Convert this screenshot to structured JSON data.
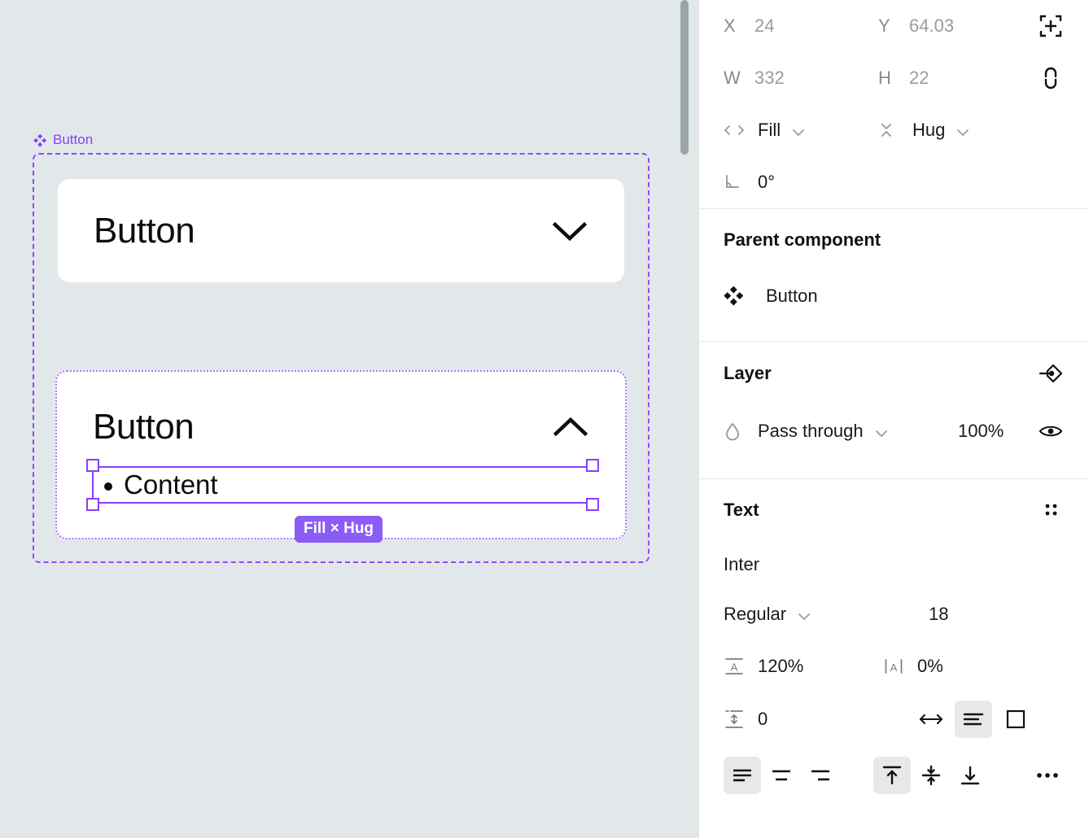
{
  "canvas": {
    "background_color": "#e2e8e9",
    "component_label": "Button",
    "component_icon": "component-diamond-icon",
    "button_one": {
      "label": "Button",
      "chevron": "chevron-down-icon"
    },
    "button_two": {
      "label": "Button",
      "chevron": "chevron-up-icon"
    },
    "content_item": {
      "text": "Content",
      "bullet": "bullet-dot-icon"
    },
    "size_badge": "Fill × Hug",
    "size_badge_color": "#8b5cf6",
    "selection_color": "#8b3dff"
  },
  "panel": {
    "position": {
      "x_label": "X",
      "x_value": "24",
      "y_label": "Y",
      "y_value": "64.03",
      "w_label": "W",
      "w_value": "332",
      "h_label": "H",
      "h_value": "22",
      "align_icon": "set-position-crosshair-icon",
      "ratio_icon": "unlink-aspect-ratio-icon",
      "horizontal_resize_icon": "horizontal-resize-icon",
      "horizontal_resize_value": "Fill",
      "vertical_resize_icon": "vertical-resize-icon",
      "vertical_resize_value": "Hug",
      "rotation_icon": "rotation-angle-icon",
      "rotation_value": "0°"
    },
    "parent_component": {
      "title": "Parent component",
      "icon": "component-diamond-icon",
      "name": "Button"
    },
    "layer": {
      "title": "Layer",
      "annotate_icon": "add-annotation-icon",
      "blend_icon": "blend-mode-drop-icon",
      "blend_mode": "Pass through",
      "opacity": "100%",
      "visibility_icon": "eye-visible-icon"
    },
    "text": {
      "title": "Text",
      "settings_icon": "type-settings-grid-icon",
      "font_family": "Inter",
      "font_weight": "Regular",
      "font_size": "18",
      "line_height_icon": "line-height-icon",
      "line_height": "120%",
      "letter_spacing_icon": "letter-spacing-icon",
      "letter_spacing": "0%",
      "paragraph_spacing_icon": "paragraph-spacing-icon",
      "paragraph_spacing": "0",
      "resize_options": [
        {
          "name": "auto-width-icon",
          "active": false
        },
        {
          "name": "auto-height-icon",
          "active": true
        },
        {
          "name": "fixed-size-icon",
          "active": false
        }
      ],
      "horizontal_align": [
        {
          "name": "align-left-icon",
          "active": true
        },
        {
          "name": "align-center-icon",
          "active": false
        },
        {
          "name": "align-right-icon",
          "active": false
        }
      ],
      "vertical_align": [
        {
          "name": "align-top-icon",
          "active": true
        },
        {
          "name": "align-middle-icon",
          "active": false
        },
        {
          "name": "align-bottom-icon",
          "active": false
        }
      ],
      "more_icon": "more-options-icon"
    }
  }
}
